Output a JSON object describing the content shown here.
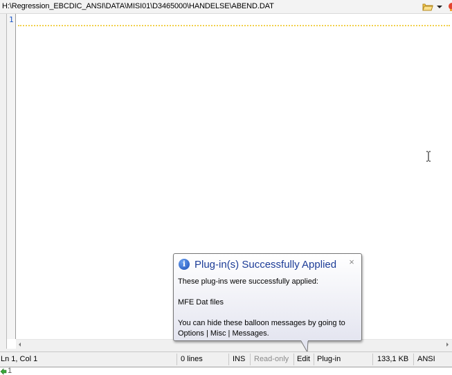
{
  "path_bar": {
    "path": "H:\\Regression_EBCDIC_ANSI\\DATA\\MISI01\\D3465000\\HANDELSE\\ABEND.DAT",
    "icons": [
      "folder-open-icon",
      "dropdown-arrow-icon",
      "notification-icon"
    ]
  },
  "editor": {
    "line_numbers": [
      "1"
    ],
    "current_line_color": "#f2d04a",
    "gutter_number_color": "#1a55c8"
  },
  "balloon": {
    "title": "Plug-in(s) Successfully Applied",
    "close_glyph": "×",
    "line1": "These plug-ins were successfully applied:",
    "line2": "MFE Dat files",
    "line3": "You can hide these balloon messages by going to",
    "line4": "Options | Misc | Messages.",
    "title_color": "#1c3c97"
  },
  "status_bar": {
    "position": "Ln 1, Col 1",
    "lines": "0 lines",
    "mode": "INS",
    "readonly": "Read-only",
    "edit": "Edit",
    "plugin": "Plug-in",
    "size": "133,1 KB",
    "encoding": "ANSI"
  },
  "tabs": [
    {
      "label": "1"
    }
  ]
}
